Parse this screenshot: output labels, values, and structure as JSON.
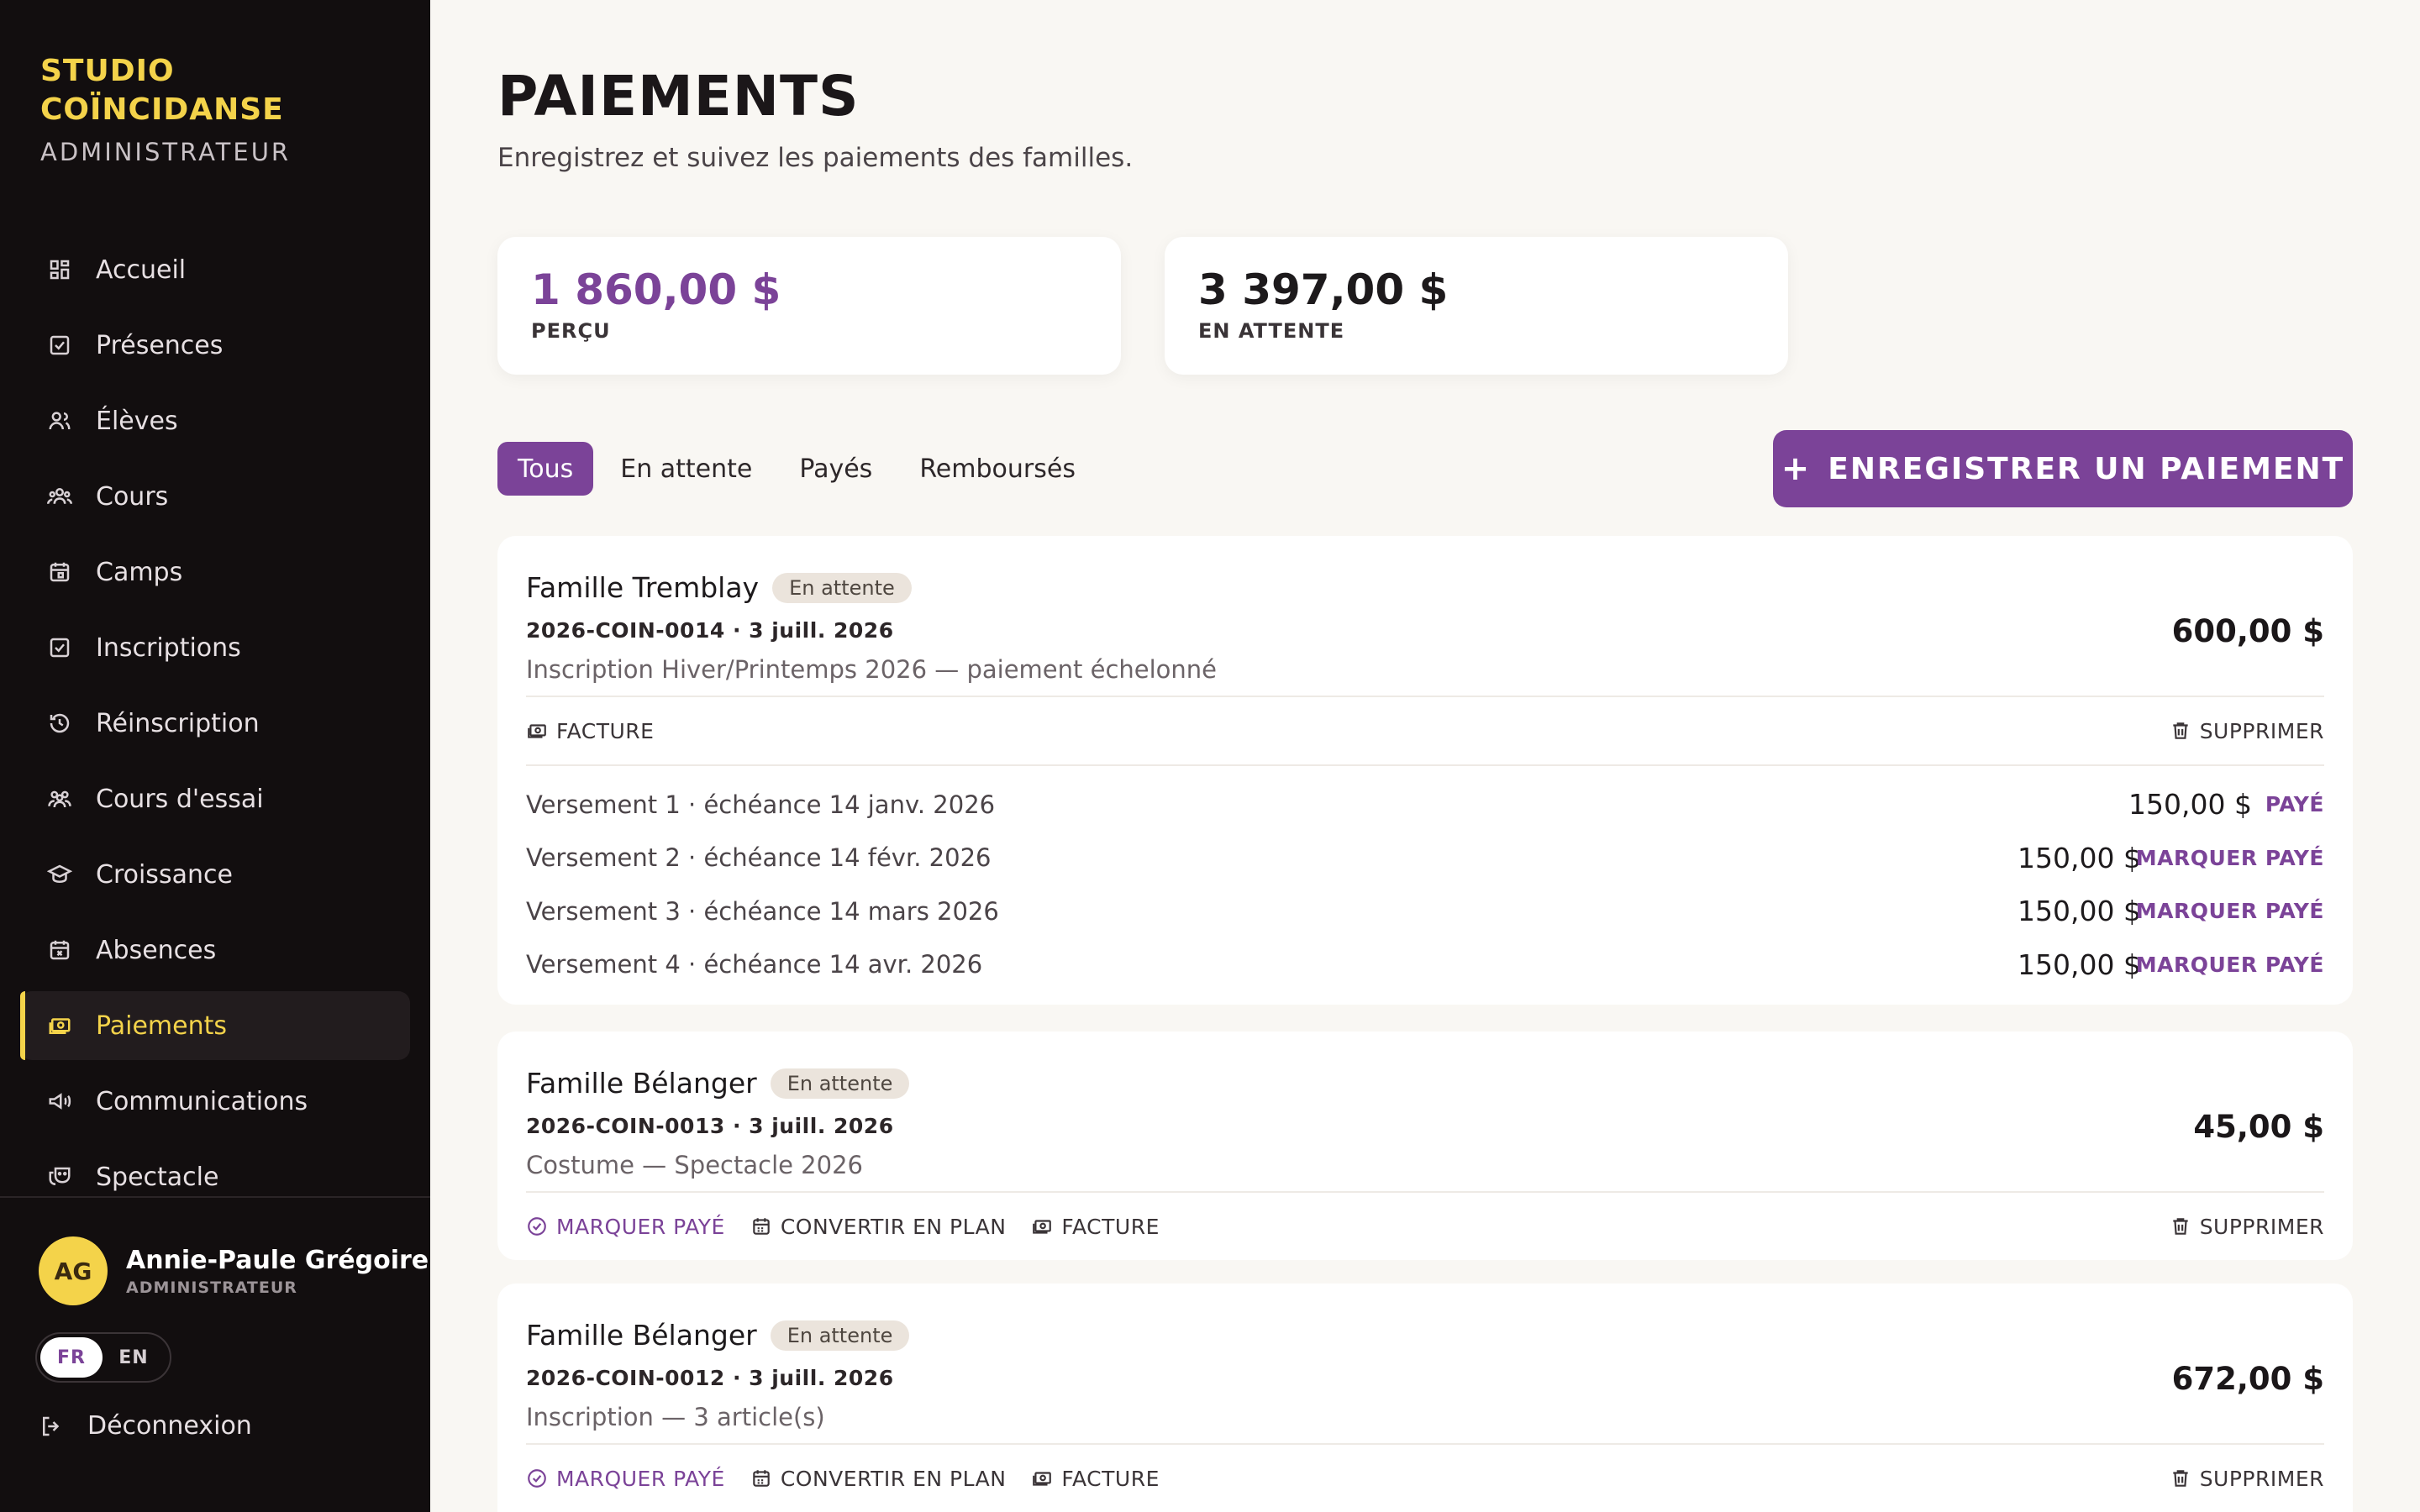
{
  "brand": {
    "title_line1": "STUDIO",
    "title_line2": "COÏNCIDANSE",
    "subtitle": "ADMINISTRATEUR"
  },
  "nav": [
    {
      "label": "Accueil",
      "icon": "dashboard-icon"
    },
    {
      "label": "Présences",
      "icon": "check-square-icon"
    },
    {
      "label": "Élèves",
      "icon": "users-icon"
    },
    {
      "label": "Cours",
      "icon": "group-icon"
    },
    {
      "label": "Camps",
      "icon": "calendar-icon"
    },
    {
      "label": "Inscriptions",
      "icon": "clipboard-check-icon"
    },
    {
      "label": "Réinscription",
      "icon": "history-icon"
    },
    {
      "label": "Cours d'essai",
      "icon": "people-icon"
    },
    {
      "label": "Croissance",
      "icon": "graduation-icon"
    },
    {
      "label": "Absences",
      "icon": "calendar-x-icon"
    },
    {
      "label": "Paiements",
      "icon": "payments-icon",
      "active": true
    },
    {
      "label": "Communications",
      "icon": "megaphone-icon"
    },
    {
      "label": "Spectacle",
      "icon": "theater-icon"
    }
  ],
  "user": {
    "initials": "AG",
    "name": "Annie-Paule Grégoire",
    "role": "ADMINISTRATEUR"
  },
  "lang": {
    "fr": "FR",
    "en": "EN"
  },
  "logout": "Déconnexion",
  "header": {
    "title": "PAIEMENTS",
    "subtitle": "Enregistrez et suivez les paiements des familles."
  },
  "stats": {
    "collected": {
      "value": "1 860,00 $",
      "label": "PERÇU"
    },
    "pending": {
      "value": "3 397,00 $",
      "label": "EN ATTENTE"
    }
  },
  "tabs": [
    "Tous",
    "En attente",
    "Payés",
    "Remboursés"
  ],
  "add_button": "ENREGISTRER UN PAIEMENT",
  "colors": {
    "accent": "#7b4398",
    "brand_yellow": "#f4d34a",
    "sidebar_bg": "#120e0f"
  },
  "payments": [
    {
      "family": "Famille Tremblay",
      "status": "En attente",
      "ref": "2026-COIN-0014 · 3 juill. 2026",
      "desc": "Inscription Hiver/Printemps 2026 — paiement échelonné",
      "amount": "600,00 $",
      "actions": {
        "invoice": "FACTURE",
        "delete": "SUPPRIMER"
      },
      "installments": [
        {
          "label": "Versement 1 · échéance 14 janv. 2026",
          "amount": "150,00 $",
          "status": "PAYÉ"
        },
        {
          "label": "Versement 2 · échéance 14 févr. 2026",
          "amount": "150,00 $",
          "status": "MARQUER PAYÉ"
        },
        {
          "label": "Versement 3 · échéance 14 mars 2026",
          "amount": "150,00 $",
          "status": "MARQUER PAYÉ"
        },
        {
          "label": "Versement 4 · échéance 14 avr. 2026",
          "amount": "150,00 $",
          "status": "MARQUER PAYÉ"
        }
      ]
    },
    {
      "family": "Famille Bélanger",
      "status": "En attente",
      "ref": "2026-COIN-0013 · 3 juill. 2026",
      "desc": "Costume — Spectacle 2026",
      "amount": "45,00 $",
      "actions": {
        "mark_paid": "MARQUER PAYÉ",
        "convert": "CONVERTIR EN PLAN",
        "invoice": "FACTURE",
        "delete": "SUPPRIMER"
      }
    },
    {
      "family": "Famille Bélanger",
      "status": "En attente",
      "ref": "2026-COIN-0012 · 3 juill. 2026",
      "desc": "Inscription — 3 article(s)",
      "amount": "672,00 $",
      "actions": {
        "mark_paid": "MARQUER PAYÉ",
        "convert": "CONVERTIR EN PLAN",
        "invoice": "FACTURE",
        "delete": "SUPPRIMER"
      }
    }
  ]
}
